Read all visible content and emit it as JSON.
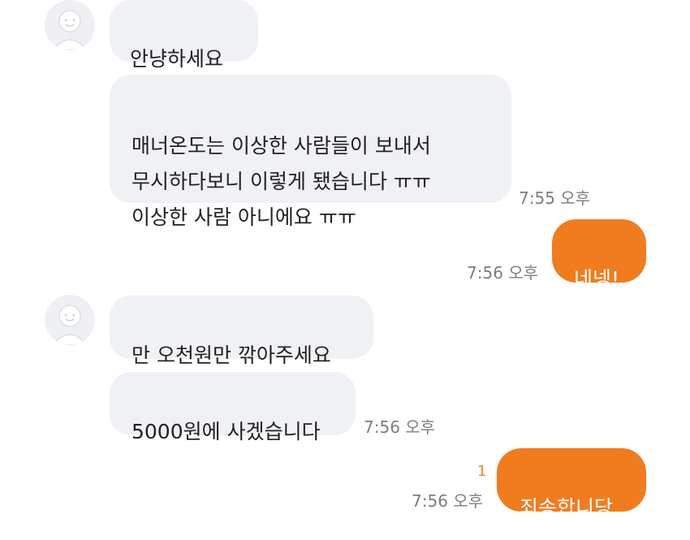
{
  "colors": {
    "incoming_bubble": "#eff1f4",
    "outgoing_bubble": "#f07c1f",
    "timestamp": "#7a7d82",
    "unread": "#e8862a"
  },
  "messages": [
    {
      "direction": "incoming",
      "text": "안냥하세요",
      "time": "",
      "avatar": "default-avatar-icon"
    },
    {
      "direction": "incoming",
      "text": "매너온도는 이상한 사람들이 보내서\n무시하다보니 이렇게 됐습니다 ㅠㅠ\n이상한 사람 아니에요 ㅠㅠ",
      "time": "7:55 오후"
    },
    {
      "direction": "outgoing",
      "text": "네넹!",
      "time": "7:56 오후"
    },
    {
      "direction": "incoming",
      "text": "만 오천원만 깎아주세요",
      "time": "",
      "avatar": "default-avatar-icon"
    },
    {
      "direction": "incoming",
      "text": "5000원에 사겠습니다",
      "time": "7:56 오후"
    },
    {
      "direction": "outgoing",
      "text": "죄송합니당",
      "time": "7:56 오후",
      "unread": "1"
    }
  ]
}
